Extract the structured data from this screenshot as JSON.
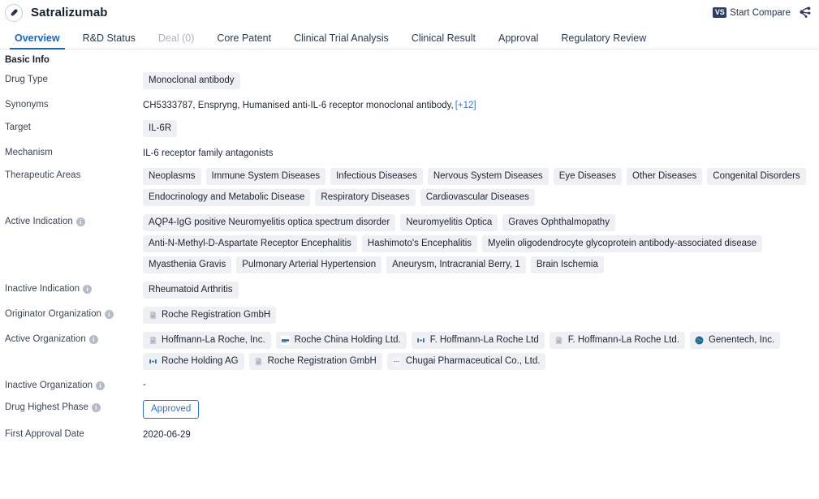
{
  "header": {
    "drug_name": "Satralizumab",
    "drug_icon": "capsule-icon",
    "compare_badge": "VS",
    "compare_label": "Start Compare",
    "share_icon": "share-network-icon"
  },
  "tabs": [
    {
      "label": "Overview",
      "state": "active"
    },
    {
      "label": "R&D Status",
      "state": "normal"
    },
    {
      "label": "Deal (0)",
      "state": "disabled"
    },
    {
      "label": "Core Patent",
      "state": "normal"
    },
    {
      "label": "Clinical Trial Analysis",
      "state": "normal"
    },
    {
      "label": "Clinical Result",
      "state": "normal"
    },
    {
      "label": "Approval",
      "state": "normal"
    },
    {
      "label": "Regulatory Review",
      "state": "normal"
    }
  ],
  "section": {
    "title": "Basic Info"
  },
  "rows": {
    "drug_type": {
      "label": "Drug Type",
      "tags": [
        "Monoclonal antibody"
      ]
    },
    "synonyms": {
      "label": "Synonyms",
      "text": "CH5333787,  Enspryng,  Humanised anti-IL-6 receptor monoclonal antibody,",
      "more": "[+12]"
    },
    "target": {
      "label": "Target",
      "tags": [
        "IL-6R"
      ]
    },
    "mechanism": {
      "label": "Mechanism",
      "text": "IL-6 receptor family antagonists"
    },
    "therapeutic_areas": {
      "label": "Therapeutic Areas",
      "tags": [
        "Neoplasms",
        "Immune System Diseases",
        "Infectious Diseases",
        "Nervous System Diseases",
        "Eye Diseases",
        "Other Diseases",
        "Congenital Disorders",
        "Endocrinology and Metabolic Disease",
        "Respiratory Diseases",
        "Cardiovascular Diseases"
      ]
    },
    "active_indication": {
      "label": "Active Indication",
      "has_info": true,
      "tags": [
        "AQP4-IgG positive Neuromyelitis optica spectrum disorder",
        "Neuromyelitis Optica",
        "Graves Ophthalmopathy",
        "Anti-N-Methyl-D-Aspartate Receptor Encephalitis",
        "Hashimoto's Encephalitis",
        "Myelin oligodendrocyte glycoprotein antibody-associated disease",
        "Myasthenia Gravis",
        "Pulmonary Arterial Hypertension",
        "Aneurysm, Intracranial Berry, 1",
        "Brain Ischemia"
      ]
    },
    "inactive_indication": {
      "label": "Inactive Indication",
      "has_info": true,
      "tags": [
        "Rheumatoid Arthritis"
      ]
    },
    "originator_organization": {
      "label": "Originator Organization",
      "has_info": true,
      "orgs": [
        {
          "name": "Roche Registration GmbH",
          "logo": "document-logo"
        }
      ]
    },
    "active_organization": {
      "label": "Active Organization",
      "has_info": true,
      "orgs": [
        {
          "name": "Hoffmann-La Roche, Inc.",
          "logo": "document-logo"
        },
        {
          "name": "Roche China Holding Ltd.",
          "logo": "blue-bar-logo"
        },
        {
          "name": "F. Hoffmann-La Roche Ltd",
          "logo": "blue-mark-logo"
        },
        {
          "name": "F. Hoffmann-La Roche Ltd.",
          "logo": "document-logo"
        },
        {
          "name": "Genentech, Inc.",
          "logo": "globe-logo"
        },
        {
          "name": "Roche Holding AG",
          "logo": "blue-mark-logo"
        },
        {
          "name": "Roche Registration GmbH",
          "logo": "document-logo"
        },
        {
          "name": "Chugai Pharmaceutical Co., Ltd.",
          "logo": "gray-dash-logo"
        }
      ]
    },
    "inactive_organization": {
      "label": "Inactive Organization",
      "has_info": true,
      "value": "-"
    },
    "drug_highest_phase": {
      "label": "Drug Highest Phase",
      "has_info": true,
      "badge": "Approved"
    },
    "first_approval_date": {
      "label": "First Approval Date",
      "value": "2020-06-29"
    }
  },
  "colors": {
    "accent": "#1a64c8",
    "tag_bg": "#eff0f3",
    "badge_border": "#2f6fd0",
    "vs_badge_bg": "#2b3f63"
  }
}
